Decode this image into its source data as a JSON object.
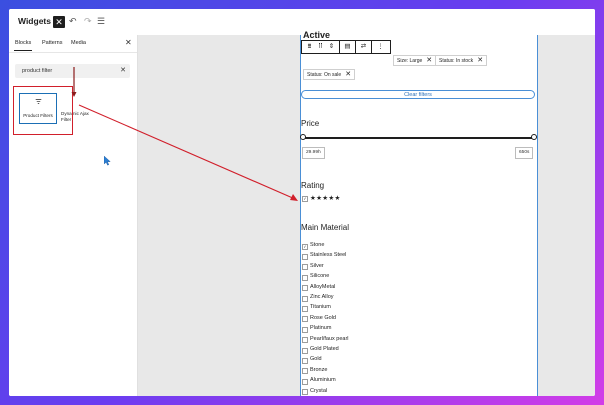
{
  "header": {
    "title": "Widgets",
    "close_icon": "close-icon",
    "undo_icon": "undo-icon",
    "redo_icon": "redo-icon",
    "list_view_icon": "list-view-icon"
  },
  "inserter": {
    "tabs": [
      "Blocks",
      "Patterns",
      "Media"
    ],
    "active_tab": "Blocks",
    "search_value": "product filter",
    "results": [
      {
        "label": "Product Filters",
        "icon": "filter-icon",
        "selected": true
      },
      {
        "label": "Dynamic Ajax Filter"
      }
    ]
  },
  "content": {
    "active_filters": [
      {
        "label": "Size: Large"
      },
      {
        "label": "Status: In stock"
      },
      {
        "label": "Status: On sale"
      }
    ],
    "clear_label": "Clear filters",
    "price": {
      "title": "Price",
      "min": "29.99h",
      "max": "650s"
    },
    "rating": {
      "title": "Rating",
      "stars": "★★★★★"
    },
    "material": {
      "title": "Main Material",
      "options": [
        {
          "label": "Stone",
          "checked": true
        },
        {
          "label": "Stainless Steel",
          "checked": false
        },
        {
          "label": "Silver",
          "checked": false
        },
        {
          "label": "Silicone",
          "checked": false
        },
        {
          "label": "AlloyMetal",
          "checked": false
        },
        {
          "label": "Zinc Alloy",
          "checked": false
        },
        {
          "label": "Titanium",
          "checked": false
        },
        {
          "label": "Rose Gold",
          "checked": false
        },
        {
          "label": "Platinum",
          "checked": false
        },
        {
          "label": "Pearl/faux pearl",
          "checked": false
        },
        {
          "label": "Gold Plated",
          "checked": false
        },
        {
          "label": "Gold",
          "checked": false
        },
        {
          "label": "Bronze",
          "checked": false
        },
        {
          "label": "Aluminium",
          "checked": false
        },
        {
          "label": "Crystal",
          "checked": false
        }
      ]
    }
  },
  "colors": {
    "accent": "#1b6fb5",
    "annotation": "#d11f2b",
    "background_gradient": [
      "#3a4fe0",
      "#d23de8"
    ]
  }
}
